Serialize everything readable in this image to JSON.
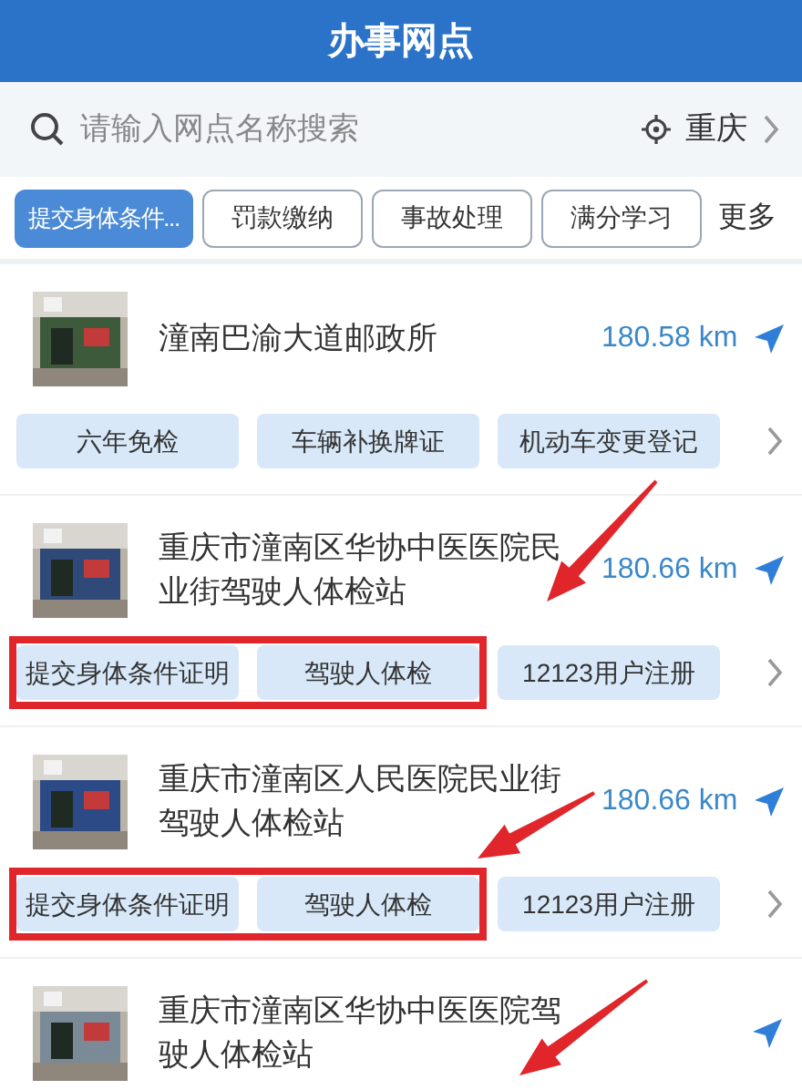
{
  "header": {
    "title": "办事网点"
  },
  "search": {
    "placeholder": "请输入网点名称搜索",
    "city": "重庆"
  },
  "tabs": [
    {
      "label": "提交身体条件...",
      "selected": true
    },
    {
      "label": "罚款缴纳",
      "selected": false
    },
    {
      "label": "事故处理",
      "selected": false
    },
    {
      "label": "满分学习",
      "selected": false
    }
  ],
  "more": "更多",
  "stations": [
    {
      "name": "潼南巴渝大道邮政所",
      "distance": "180.58 km",
      "services": [
        "六年免检",
        "车辆补换牌证",
        "机动车变更登记"
      ],
      "framed": false,
      "arrow": false
    },
    {
      "name": "重庆市潼南区华协中医医院民业街驾驶人体检站",
      "distance": "180.66 km",
      "services": [
        "提交身体条件证明",
        "驾驶人体检",
        "12123用户注册"
      ],
      "framed": true,
      "arrow": true
    },
    {
      "name": "重庆市潼南区人民医院民业街驾驶人体检站",
      "distance": "180.66 km",
      "services": [
        "提交身体条件证明",
        "驾驶人体检",
        "12123用户注册"
      ],
      "framed": true,
      "arrow": true
    },
    {
      "name": "重庆市潼南区华协中医医院驾驶人体检站",
      "framed": false,
      "arrow": true
    }
  ]
}
